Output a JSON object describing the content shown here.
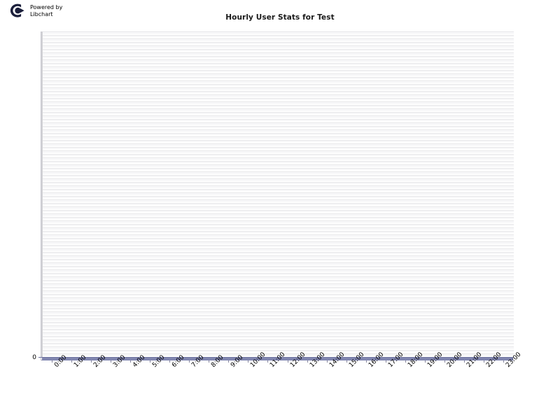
{
  "branding": {
    "logo_icon": "libchart-logo-icon",
    "line1": "Powered by",
    "line2": "Libchart"
  },
  "chart_data": {
    "type": "bar",
    "title": "Hourly User Stats for Test",
    "xlabel": "",
    "ylabel": "",
    "grid": true,
    "legend": "none",
    "ylim": [
      0,
      0
    ],
    "yticks": [
      "0"
    ],
    "categories": [
      "0:00",
      "1:00",
      "2:00",
      "3:00",
      "4:00",
      "5:00",
      "6:00",
      "7:00",
      "8:00",
      "9:00",
      "10:00",
      "11:00",
      "12:00",
      "13:00",
      "14:00",
      "15:00",
      "16:00",
      "17:00",
      "18:00",
      "19:00",
      "20:00",
      "21:00",
      "22:00",
      "23:00"
    ],
    "values": [
      0,
      0,
      0,
      0,
      0,
      0,
      0,
      0,
      0,
      0,
      0,
      0,
      0,
      0,
      0,
      0,
      0,
      0,
      0,
      0,
      0,
      0,
      0,
      0
    ],
    "series_color": "#8186b0"
  },
  "colors": {
    "bar": "#8186b0",
    "bar_border": "#6f74a0",
    "gridline": "#e3e3e6",
    "axis": "#9a9ab2",
    "plot_background": "#ffffff",
    "page_background": "#ffffff",
    "title_text": "#1a1a1a",
    "logo": "#1b1f3b"
  }
}
